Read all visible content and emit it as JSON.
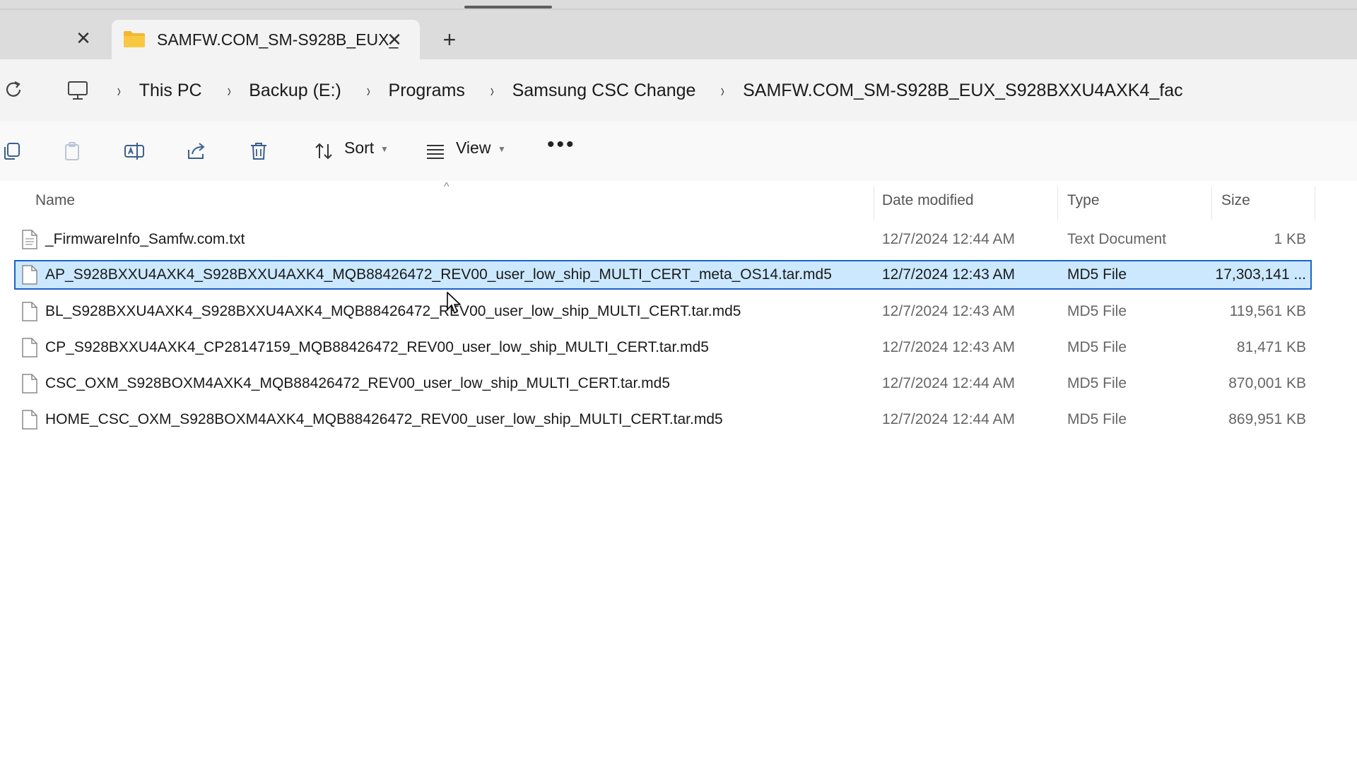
{
  "window": {
    "tab_title": "SAMFW.COM_SM-S928B_EUX_",
    "new_tab_label": "+",
    "close_glyph": "✕"
  },
  "address": {
    "crumbs": [
      "This PC",
      "Backup (E:)",
      "Programs",
      "Samsung CSC Change",
      "SAMFW.COM_SM-S928B_EUX_S928BXXU4AXK4_fac"
    ],
    "separator": "›"
  },
  "toolbar": {
    "sort_label": "Sort",
    "view_label": "View",
    "more_label": "•••"
  },
  "columns": {
    "name": "Name",
    "date": "Date modified",
    "type": "Type",
    "size": "Size"
  },
  "files": [
    {
      "name": "_FirmwareInfo_Samfw.com.txt",
      "date": "12/7/2024 12:44 AM",
      "type": "Text Document",
      "size": "1 KB",
      "selected": false
    },
    {
      "name": "AP_S928BXXU4AXK4_S928BXXU4AXK4_MQB88426472_REV00_user_low_ship_MULTI_CERT_meta_OS14.tar.md5",
      "date": "12/7/2024 12:43 AM",
      "type": "MD5 File",
      "size": "17,303,141 ...",
      "selected": true
    },
    {
      "name": "BL_S928BXXU4AXK4_S928BXXU4AXK4_MQB88426472_REV00_user_low_ship_MULTI_CERT.tar.md5",
      "date": "12/7/2024 12:43 AM",
      "type": "MD5 File",
      "size": "119,561 KB",
      "selected": false
    },
    {
      "name": "CP_S928BXXU4AXK4_CP28147159_MQB88426472_REV00_user_low_ship_MULTI_CERT.tar.md5",
      "date": "12/7/2024 12:43 AM",
      "type": "MD5 File",
      "size": "81,471 KB",
      "selected": false
    },
    {
      "name": "CSC_OXM_S928BOXM4AXK4_MQB88426472_REV00_user_low_ship_MULTI_CERT.tar.md5",
      "date": "12/7/2024 12:44 AM",
      "type": "MD5 File",
      "size": "870,001 KB",
      "selected": false
    },
    {
      "name": "HOME_CSC_OXM_S928BOXM4AXK4_MQB88426472_REV00_user_low_ship_MULTI_CERT.tar.md5",
      "date": "12/7/2024 12:44 AM",
      "type": "MD5 File",
      "size": "869,951 KB",
      "selected": false
    }
  ],
  "colors": {
    "selection_fill": "#cce8ff",
    "selection_border": "#1a63c8",
    "folder_yellow": "#f8c940"
  },
  "icons": {
    "tab": "folder-icon",
    "refresh": "refresh-icon",
    "pc": "monitor-icon",
    "copy": "copy-icon",
    "paste": "paste-icon",
    "rename": "rename-icon",
    "share": "share-icon",
    "delete": "trash-icon",
    "sort": "sort-icon",
    "view": "view-list-icon",
    "file": "file-icon"
  }
}
